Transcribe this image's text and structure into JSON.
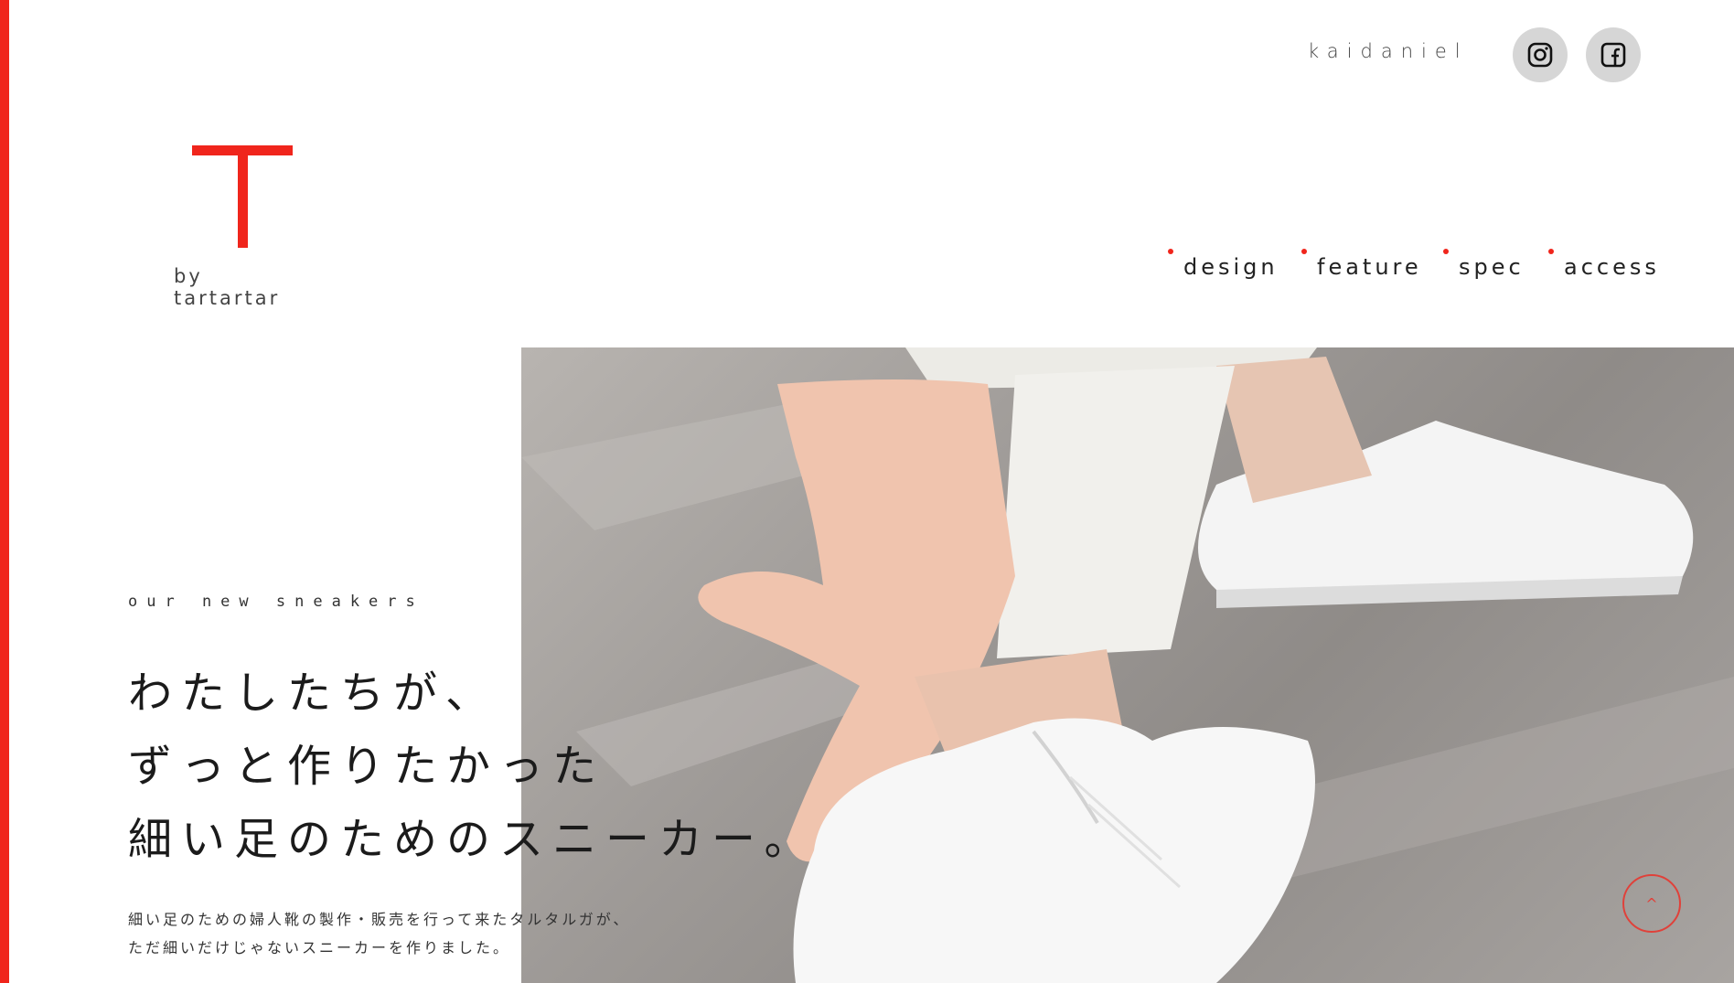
{
  "header": {
    "username": "kaidaniel",
    "social": [
      {
        "name": "instagram-icon"
      },
      {
        "name": "facebook-icon"
      }
    ]
  },
  "logo": {
    "letter": "T",
    "subtitle": "by tartartar"
  },
  "nav": {
    "items": [
      {
        "label": "design"
      },
      {
        "label": "feature"
      },
      {
        "label": "spec"
      },
      {
        "label": "access"
      }
    ]
  },
  "hero": {
    "eyebrow": "our new sneakers",
    "headline": [
      "わたしたちが、",
      "ずっと作りたかった",
      "細い足のためのスニーカー。"
    ],
    "body": [
      "細い足のための婦人靴の製作・販売を行って来たタルタルガが、",
      "ただ細いだけじゃないスニーカーを作りました。"
    ]
  },
  "scroll_top": {
    "label": "^"
  },
  "colors": {
    "accent": "#f0251c",
    "social_bg": "#d6d6d6",
    "text": "#222222"
  }
}
